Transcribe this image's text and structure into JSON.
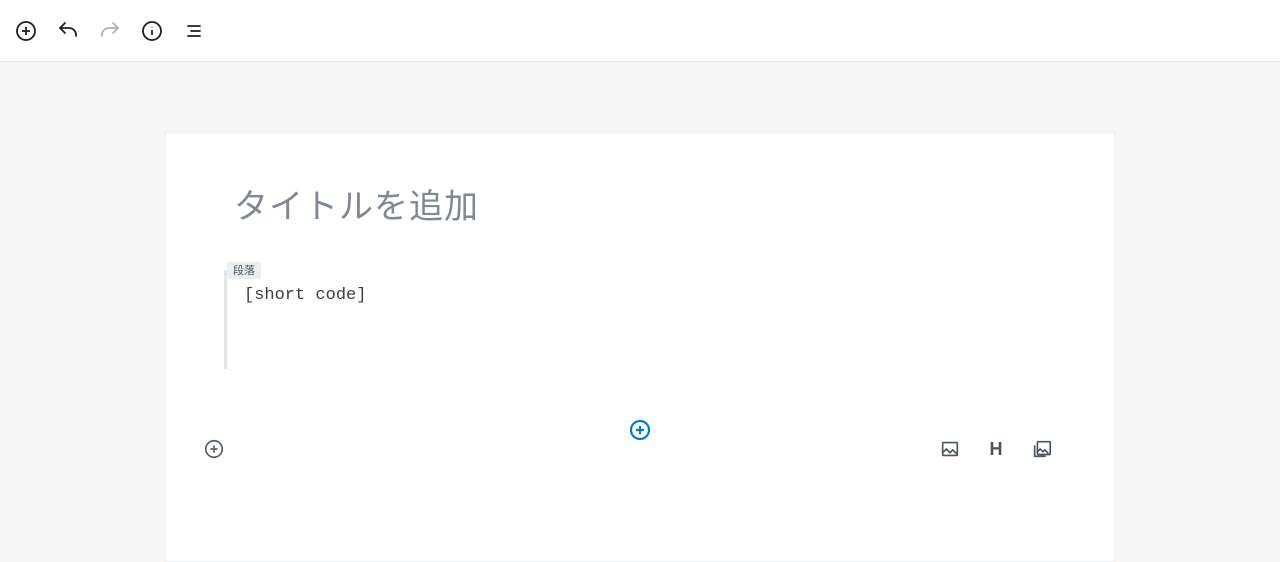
{
  "toolbar": {
    "add_block_name": "add-block-button",
    "undo_name": "undo-button",
    "redo_name": "redo-button",
    "info_name": "content-structure-button",
    "outline_name": "block-navigation-button"
  },
  "editor": {
    "title_placeholder": "タイトルを追加",
    "block_type_label": "段落",
    "block_content": "[short code]",
    "mid_inserter_name": "insert-block-button",
    "footer_inserter_name": "footer-add-block-button",
    "quick_image_name": "image-block-button",
    "quick_heading_name": "heading-block-button",
    "quick_gallery_name": "gallery-block-button"
  }
}
